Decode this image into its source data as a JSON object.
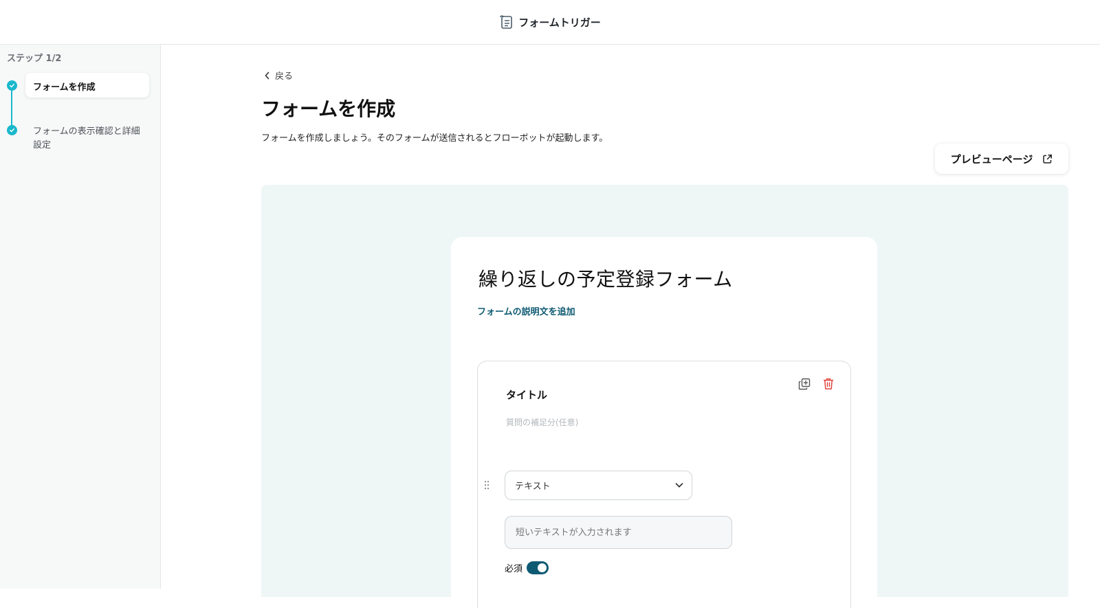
{
  "header": {
    "title": "フォームトリガー",
    "icon": "form-list-icon"
  },
  "sidebar": {
    "step_count": "ステップ 1/2",
    "steps": [
      {
        "label": "フォームを作成",
        "status": "active",
        "icon": "check-icon"
      },
      {
        "label": "フォームの表示確認と詳細設定",
        "status": "complete",
        "icon": "check-icon"
      }
    ],
    "accent_color": "#19b8cc"
  },
  "main": {
    "back_label": "戻る",
    "title": "フォームを作成",
    "description": "フォームを作成しましょう。そのフォームが送信されるとフローボットが起動します。",
    "preview_button": {
      "label": "プレビューページ",
      "icon": "external-link-icon"
    }
  },
  "form": {
    "title": "繰り返しの予定登録フォーム",
    "add_description_label": "フォームの説明文を追加",
    "canvas_color": "#eff7f6",
    "question": {
      "title": "タイトル",
      "help_placeholder": "質問の補足分(任意)",
      "type_value": "テキスト",
      "answer_placeholder": "短いテキストが入力されます",
      "required_label": "必須",
      "required_on": true,
      "toggle_color": "#0e5a73",
      "delete_color": "#e0443e"
    }
  }
}
